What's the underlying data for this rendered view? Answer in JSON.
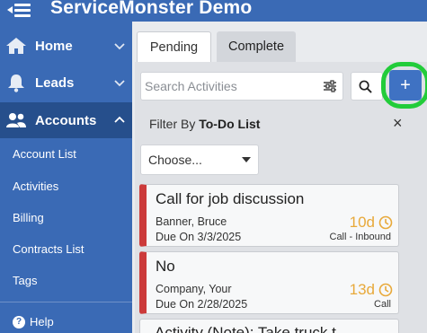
{
  "app": {
    "title": "ServiceMonster Demo"
  },
  "sidebar": {
    "nav": [
      {
        "label": "Home",
        "icon": "home-icon"
      },
      {
        "label": "Leads",
        "icon": "bell-icon"
      },
      {
        "label": "Accounts",
        "icon": "users-icon"
      }
    ],
    "sub_items": [
      "Account List",
      "Activities",
      "Billing",
      "Contracts List",
      "Tags"
    ],
    "help_label": "Help"
  },
  "tabs": {
    "pending": "Pending",
    "complete": "Complete"
  },
  "search": {
    "placeholder": "Search Activities",
    "value": ""
  },
  "add_button": "+",
  "filter": {
    "prefix": "Filter By",
    "value": "To-Do List",
    "close": "×"
  },
  "select": {
    "value": "Choose..."
  },
  "activities": [
    {
      "title": "Call for job discussion",
      "contact": "Banner, Bruce",
      "due": "Due On 3/3/2025",
      "days": "10d",
      "type": "Call - Inbound"
    },
    {
      "title": "No",
      "contact": "Company, Your",
      "due": "Due On 2/28/2025",
      "days": "13d",
      "type": "Call"
    },
    {
      "title": "Activity (Note): Take truck t"
    }
  ],
  "colors": {
    "brand": "#3a6ab5",
    "brand_dark": "#264f8c",
    "accent_add": "#3f72c3",
    "highlight_ring": "#22cc3a",
    "overdue_bar": "#cc3a3a",
    "days": "#e8a93a"
  }
}
